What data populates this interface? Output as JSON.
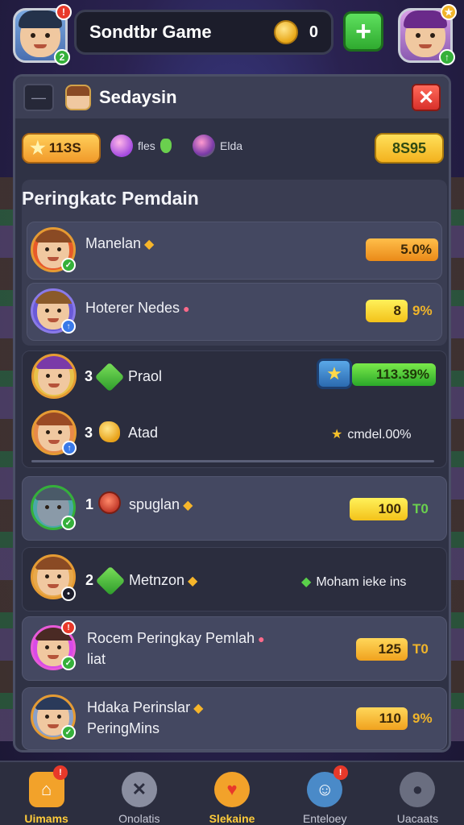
{
  "header": {
    "title": "Sondtbr Game",
    "coins": "0",
    "plus_label": "+"
  },
  "panel": {
    "title": "Sedaysin",
    "back_label": "—",
    "close_label": "✕"
  },
  "resources": {
    "stars": "11ЗS",
    "gem1_label": "fles",
    "gem2_label": "Elda",
    "score": "8Ѕ95"
  },
  "ranking": {
    "title": "Peringkatc Pemdain",
    "rows": [
      {
        "name": "Manelan",
        "value": "5.0%"
      },
      {
        "name": "Hoterer Nedes",
        "value": "8",
        "extra": "9%"
      },
      {
        "rank": "3",
        "name": "Praol",
        "value": "113.39%"
      },
      {
        "rank": "3",
        "name": "Atad",
        "value": "cmdel.00%"
      },
      {
        "rank": "1",
        "name": "spuglan",
        "value": "100",
        "extra": "T0"
      },
      {
        "rank": "2",
        "name": "Metnzon",
        "value": "Moham ieke ins"
      },
      {
        "name": "Rocem Peringkay Pemlah",
        "name2": "liat",
        "value": "125",
        "extra": "T0"
      },
      {
        "name": "Hdaka Perinslar",
        "name2": "PeringMins",
        "value": "110",
        "extra": "9%"
      }
    ]
  },
  "nav": {
    "items": [
      {
        "label": "Uimams",
        "icon": "home-icon"
      },
      {
        "label": "Onolatis",
        "icon": "crossed-swords-icon"
      },
      {
        "label": "Slekaine",
        "icon": "heart-shield-icon"
      },
      {
        "label": "Enteloey",
        "icon": "profile-icon"
      },
      {
        "label": "Uacaats",
        "icon": "user-icon"
      }
    ]
  },
  "colors": {
    "accent_gold": "#f3b21e",
    "accent_green": "#2faa2f",
    "close_red": "#d8302a",
    "panel_bg": "#2f3245"
  }
}
